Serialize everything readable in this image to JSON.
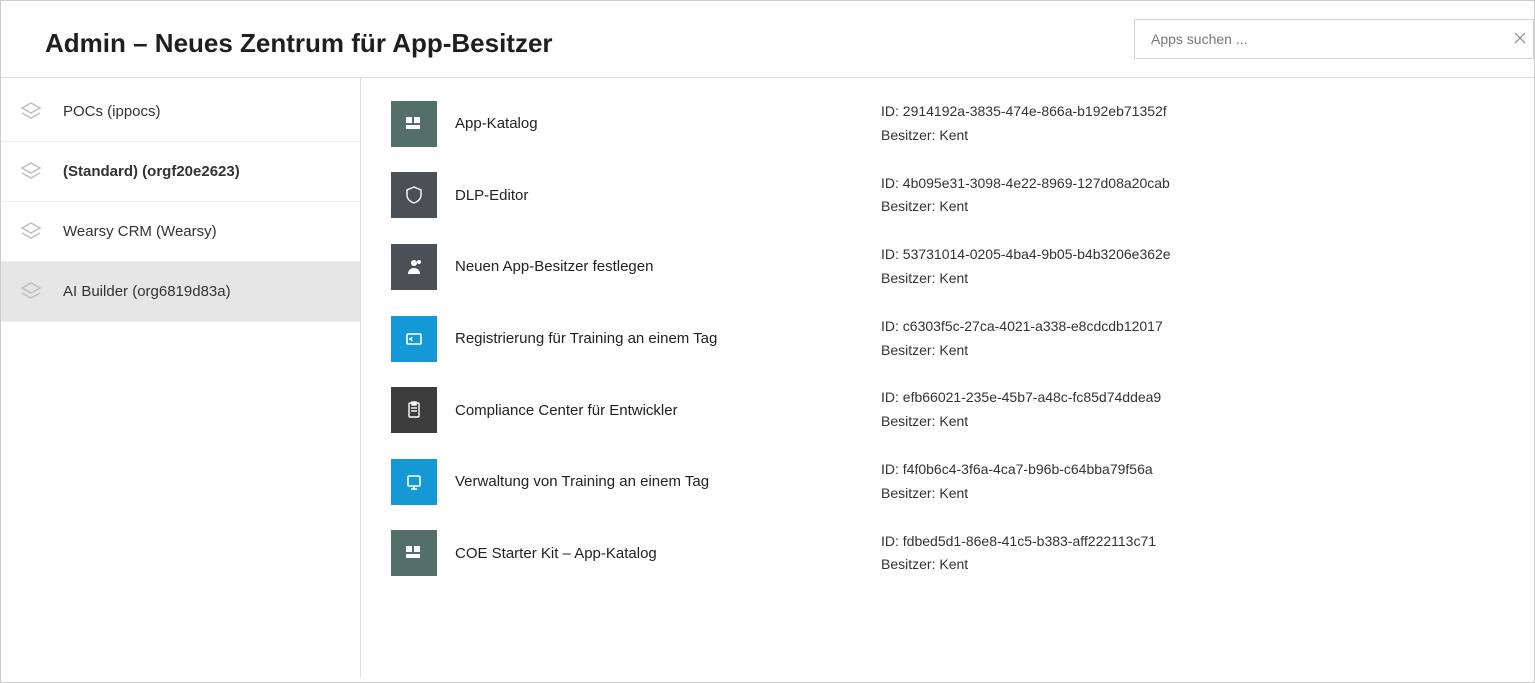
{
  "header": {
    "title": "Admin – Neues Zentrum für App-Besitzer",
    "search_placeholder": "Apps suchen ..."
  },
  "sidebar": {
    "items": [
      {
        "label": "POCs (ippocs)",
        "selected": false,
        "default": false
      },
      {
        "label": "(Standard) (orgf20e2623)",
        "selected": false,
        "default": true
      },
      {
        "label": "Wearsy CRM (Wearsy)",
        "selected": false,
        "default": false
      },
      {
        "label": "AI Builder (org6819d83a)",
        "selected": true,
        "default": false
      }
    ]
  },
  "labels": {
    "id_prefix": "ID: ",
    "owner_prefix": "Besitzer: "
  },
  "apps": [
    {
      "name": "App-Katalog",
      "id": "2914192a-3835-474e-866a-b192eb71352f",
      "owner": "Kent",
      "tile": "tile-green",
      "icon": "grid"
    },
    {
      "name": "DLP-Editor",
      "id": "4b095e31-3098-4e22-8969-127d08a20cab",
      "owner": "Kent",
      "tile": "tile-slate",
      "icon": "shield"
    },
    {
      "name": "Neuen App-Besitzer festlegen",
      "id": "53731014-0205-4ba4-9b05-b4b3206e362e",
      "owner": "Kent",
      "tile": "tile-slate",
      "icon": "person"
    },
    {
      "name": "Registrierung für Training an einem Tag",
      "id": "c6303f5c-27ca-4021-a338-e8cdcdb12017",
      "owner": "Kent",
      "tile": "tile-blue",
      "icon": "training"
    },
    {
      "name": "Compliance Center für Entwickler",
      "id": "efb66021-235e-45b7-a48c-fc85d74ddea9",
      "owner": "Kent",
      "tile": "tile-dark",
      "icon": "clipboard"
    },
    {
      "name": "Verwaltung von Training an einem Tag",
      "id": "f4f0b6c4-3f6a-4ca7-b96b-c64bba79f56a",
      "owner": "Kent",
      "tile": "tile-blue",
      "icon": "manage"
    },
    {
      "name": "COE Starter Kit – App-Katalog",
      "id": "fdbed5d1-86e8-41c5-b383-aff222113c71",
      "owner": "Kent",
      "tile": "tile-green",
      "icon": "grid"
    }
  ]
}
